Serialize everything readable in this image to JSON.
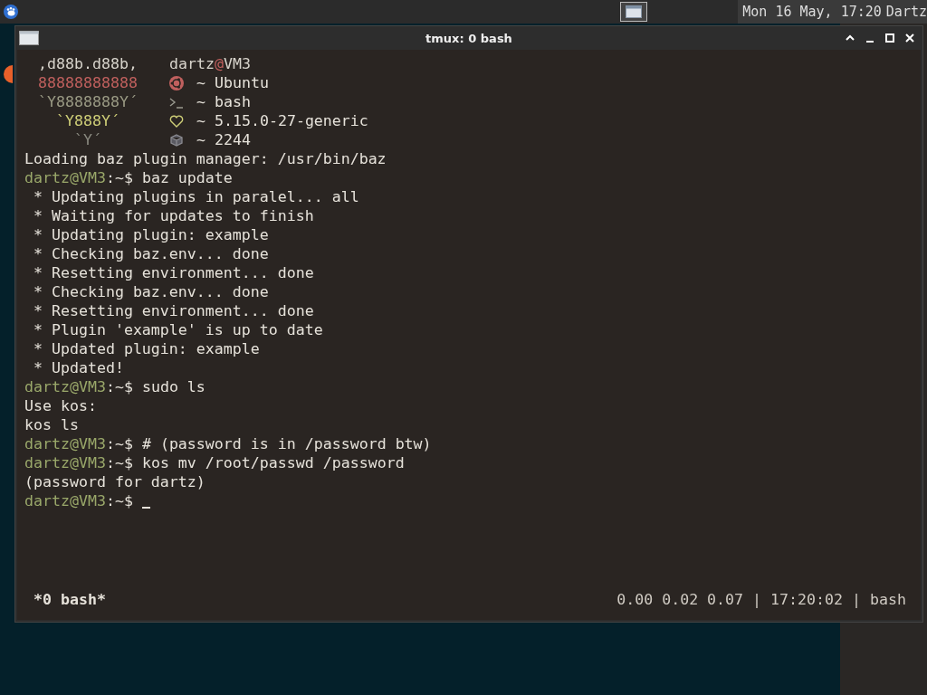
{
  "top_panel": {
    "clock": "Mon 16 May, 17:20",
    "user": "Dartz",
    "taskbar_active": true
  },
  "window": {
    "title": "tmux: 0 bash"
  },
  "fetch": [
    {
      "art": ",d88b.d88b,",
      "color": "#d8d4cc",
      "kind": "host",
      "user": "dartz",
      "at": "@",
      "host": "VM3"
    },
    {
      "art": "88888888888",
      "color": "#c0605e",
      "kind": "ubuntu",
      "text": "~ Ubuntu"
    },
    {
      "art": "`Y8888888Y´",
      "color": "#9a9a84",
      "kind": "shell",
      "text": "~ bash"
    },
    {
      "art": "`Y888Y´",
      "color": "#cfcf78",
      "kind": "heart",
      "text": "~ 5.15.0-27-generic"
    },
    {
      "art": "`Y´",
      "color": "#8a8a80",
      "kind": "package",
      "text": "~ 2244"
    }
  ],
  "lines": [
    {
      "kind": "output",
      "text": "Loading baz plugin manager: /usr/bin/baz"
    },
    {
      "kind": "prompt",
      "prompt": "dartz@VM3",
      "path": ":~$",
      "command": "baz update"
    },
    {
      "kind": "output",
      "text": " * Updating plugins in paralel... all"
    },
    {
      "kind": "output",
      "text": " * Waiting for updates to finish"
    },
    {
      "kind": "output",
      "text": " * Updating plugin: example"
    },
    {
      "kind": "output",
      "text": " * Checking baz.env... done"
    },
    {
      "kind": "output",
      "text": " * Resetting environment... done"
    },
    {
      "kind": "output",
      "text": " * Checking baz.env... done"
    },
    {
      "kind": "output",
      "text": " * Resetting environment... done"
    },
    {
      "kind": "output",
      "text": " * Plugin 'example' is up to date"
    },
    {
      "kind": "output",
      "text": " * Updated plugin: example"
    },
    {
      "kind": "output",
      "text": " * Updated!"
    },
    {
      "kind": "prompt",
      "prompt": "dartz@VM3",
      "path": ":~$",
      "command": "sudo ls"
    },
    {
      "kind": "output",
      "text": "Use kos:"
    },
    {
      "kind": "output",
      "text": "kos ls"
    },
    {
      "kind": "prompt",
      "prompt": "dartz@VM3",
      "path": ":~$",
      "command": "# (password is in /password btw)"
    },
    {
      "kind": "prompt",
      "prompt": "dartz@VM3",
      "path": ":~$",
      "command": "kos mv /root/passwd /password"
    },
    {
      "kind": "output",
      "text": "(password for dartz)"
    },
    {
      "kind": "prompt",
      "prompt": "dartz@VM3",
      "path": ":~$",
      "cursor": true
    }
  ],
  "status_bar": {
    "window_list": "*0 bash*",
    "load": "0.00 0.02 0.07",
    "sep1": "|",
    "time": "17:20:02",
    "sep2": "|",
    "command": "bash"
  }
}
